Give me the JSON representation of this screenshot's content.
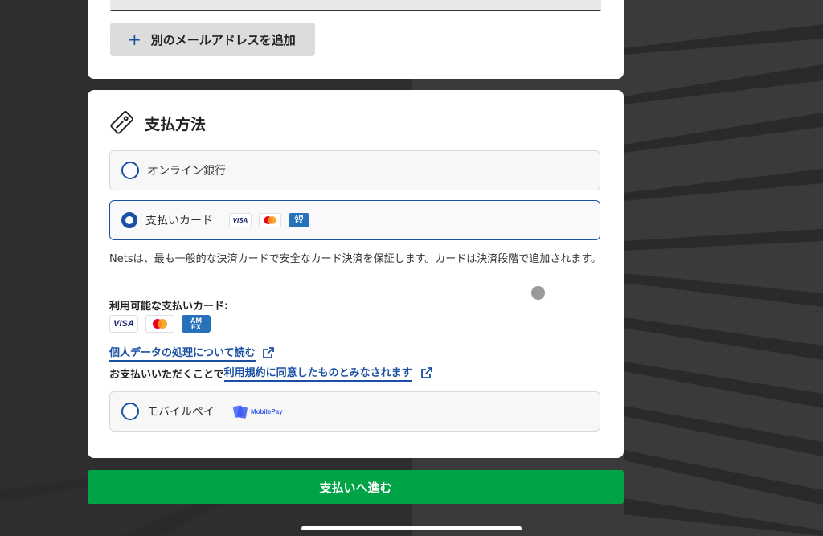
{
  "email_section": {
    "add_email_label": "別のメールアドレスを追加"
  },
  "payment": {
    "title": "支払方法",
    "options": [
      {
        "label": "オンライン銀行",
        "selected": false
      },
      {
        "label": "支払いカード",
        "selected": true
      },
      {
        "label": "モバイルペイ",
        "selected": false
      }
    ],
    "card_logos": {
      "visa": "VISA",
      "amex_top": "AM",
      "amex_bottom": "EX"
    },
    "mobilepay_logo": "MobilePay",
    "description": "Netsは、最も一般的な決済カードで安全なカード決済を保証します。カードは決済段階で追加されます。",
    "available_cards_title": "利用可能な支払いカード:",
    "privacy_link": "個人データの処理について読む",
    "terms_prefix": "お支払いいただくことで",
    "terms_link": "利用規約に同意したものとみなされます"
  },
  "proceed_button": "支払いへ進む",
  "colors": {
    "accent": "#1a4fa3",
    "proceed": "#00a346",
    "card_bg": "#ffffff",
    "page_bg": "#333333"
  }
}
